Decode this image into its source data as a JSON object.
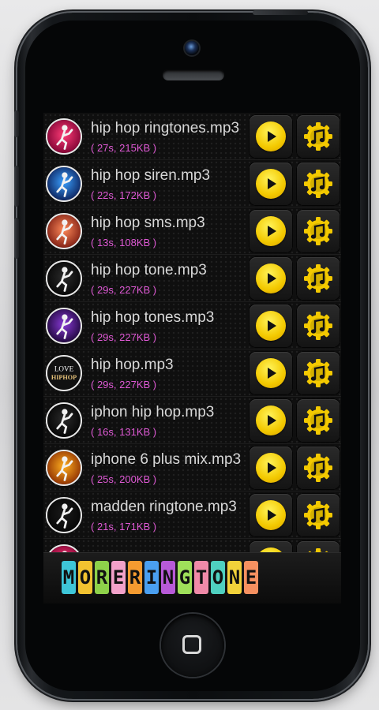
{
  "ringtones": [
    {
      "title": "hip hop ringtones.mp3",
      "meta": "( 27s, 215KB )"
    },
    {
      "title": "hip hop siren.mp3",
      "meta": "( 22s, 172KB )"
    },
    {
      "title": "hip hop sms.mp3",
      "meta": "( 13s, 108KB )"
    },
    {
      "title": "hip hop tone.mp3",
      "meta": "( 29s, 227KB )"
    },
    {
      "title": "hip hop tones.mp3",
      "meta": "( 29s, 227KB )"
    },
    {
      "title": "hip hop.mp3",
      "meta": "( 29s, 227KB )"
    },
    {
      "title": "iphon hip hop.mp3",
      "meta": "( 16s, 131KB )"
    },
    {
      "title": "iphone 6 plus mix.mp3",
      "meta": "( 25s, 200KB )"
    },
    {
      "title": "madden ringtone.mp3",
      "meta": "( 21s, 171KB )"
    }
  ],
  "avatar_love_text": "LOVE",
  "avatar_hiphop_text": "HIPHOP",
  "banner": {
    "text": "MORERINGTONE",
    "letter_colors": [
      "#3ec6d8",
      "#f2c230",
      "#8ed14a",
      "#f2a1c9",
      "#f59b30",
      "#4a9ff0",
      "#b85ad8",
      "#9fe05a",
      "#f08aa8",
      "#4fd0c0",
      "#f2d23a",
      "#f59060"
    ]
  },
  "colors": {
    "accent_yellow": "#f3c900",
    "meta_pink": "#e05ad6",
    "title_gray": "#d8d8d8"
  },
  "icons": {
    "play": "play-icon",
    "set": "gear-music-note-icon"
  }
}
